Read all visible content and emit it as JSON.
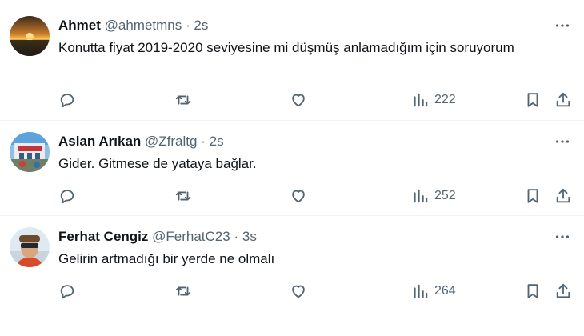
{
  "tweets": [
    {
      "name": "Ahmet",
      "handle": "@ahmetmns",
      "separator": "·",
      "time": "2s",
      "text": "Konutta fiyat 2019-2020 seviyesine mi düşmüş anlamadığım için soruyorum",
      "views": "222"
    },
    {
      "name": "Aslan Arıkan",
      "handle": "@Zfraltg",
      "separator": "·",
      "time": "2s",
      "text": "Gider. Gitmese de yataya bağlar.",
      "views": "252"
    },
    {
      "name": "Ferhat Cengiz",
      "handle": "@FerhatC23",
      "separator": "·",
      "time": "3s",
      "text": "Gelirin artmadığı bir yerde ne olmalı",
      "views": "264"
    }
  ],
  "icons": {
    "reply": "reply-icon",
    "retweet": "retweet-icon",
    "like": "like-icon",
    "views": "views-icon",
    "bookmark": "bookmark-icon",
    "share": "share-icon",
    "more": "more-icon"
  },
  "colors": {
    "text": "#0f1419",
    "secondary": "#536471",
    "divider": "#eff3f4"
  }
}
